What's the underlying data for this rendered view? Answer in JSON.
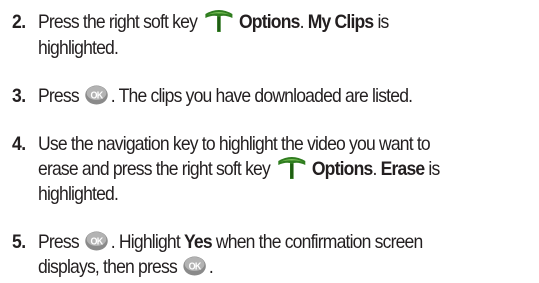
{
  "steps": [
    {
      "number": "2.",
      "line1": {
        "pre": "Press the right soft key ",
        "bold": "Options",
        "mid": ". ",
        "bold2": "My Clips",
        "post": " is"
      },
      "line2": "highlighted."
    },
    {
      "number": "3.",
      "line1": {
        "pre": "Press ",
        "post": ". The clips you have downloaded are listed."
      }
    },
    {
      "number": "4.",
      "line1": "Use the navigation key to highlight the video you want to",
      "line2": {
        "pre": "erase and press the right soft key ",
        "bold": "Options",
        "mid": ". ",
        "bold2": "Erase",
        "post": " is"
      },
      "line3": "highlighted."
    },
    {
      "number": "5.",
      "line1": {
        "pre": "Press ",
        "mid": ". Highlight ",
        "bold": "Yes",
        "post": " when the confirmation screen"
      },
      "line2": {
        "pre": "displays, then press ",
        "post": "."
      }
    }
  ],
  "icons": {
    "softkey": "right-soft-key-icon",
    "ok": "ok-button-icon"
  },
  "colors": {
    "text": "#231f20",
    "softkey_green": "#2f7d1f",
    "ok_gray": "#8a8a8a"
  }
}
